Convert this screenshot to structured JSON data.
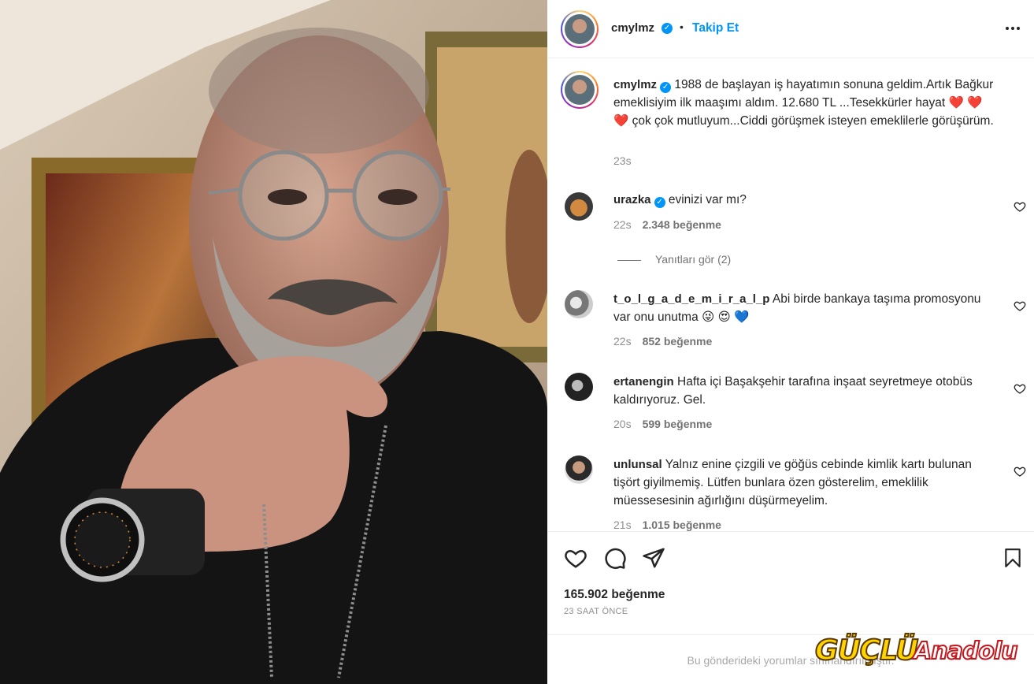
{
  "post": {
    "username": "cmylmz",
    "follow_label": "Takip Et",
    "dot": "•",
    "more_icon": "more-horizontal-icon",
    "caption": "1988 de başlayan iş hayatımın sonuna geldim.Artık Bağkur emeklisiyim ilk maaşımı aldım. 12.680 TL ...Tesekkürler hayat ❤️ ❤️ ❤️  çok çok mutluyum...Ciddi görüşmek isteyen emeklilerle görüşürüm.",
    "caption_time": "23s"
  },
  "comments": [
    {
      "username": "urazka",
      "verified": true,
      "text": "evinizi var mı?",
      "time": "22s",
      "likes": "2.348 beğenme"
    },
    {
      "username": "t_o_l_g_a_d_e_m_i_r_a_l_p",
      "verified": false,
      "text": "Abi birde bankaya taşıma promosyonu var onu unutma 😜 😍 💙",
      "time": "22s",
      "likes": "852 beğenme"
    },
    {
      "username": "ertanengin",
      "verified": false,
      "text": "Hafta içi Başakşehir tarafına inşaat seyretmeye otobüs kaldırıyoruz. Gel.",
      "time": "20s",
      "likes": "599 beğenme"
    },
    {
      "username": "unlunsal",
      "verified": false,
      "text": "Yalnız enine çizgili ve göğüs cebinde kimlik kartı bulunan tişört giyilmemiş. Lütfen bunlara özen gösterelim, emeklilik müessesesinin ağırlığını düşürmeyelim.",
      "time": "21s",
      "likes": "1.015 beğenme"
    }
  ],
  "replies_label": "Yanıtları gör (2)",
  "actions": {
    "like_icon": "heart-icon",
    "comment_icon": "comment-icon",
    "share_icon": "share-icon",
    "save_icon": "bookmark-icon",
    "likes": "165.902 beğenme",
    "time_ago": "23 SAAT ÖNCE"
  },
  "disabled_notice": "Bu gönderideki yorumlar sınırlandırılmıştır.",
  "watermark": {
    "part1": "GÜÇLÜ",
    "part2": "Anadolu"
  },
  "colors": {
    "accent": "#0095f6",
    "text": "#262626",
    "muted": "#8e8e8e",
    "heart_red": "#ed4956"
  }
}
